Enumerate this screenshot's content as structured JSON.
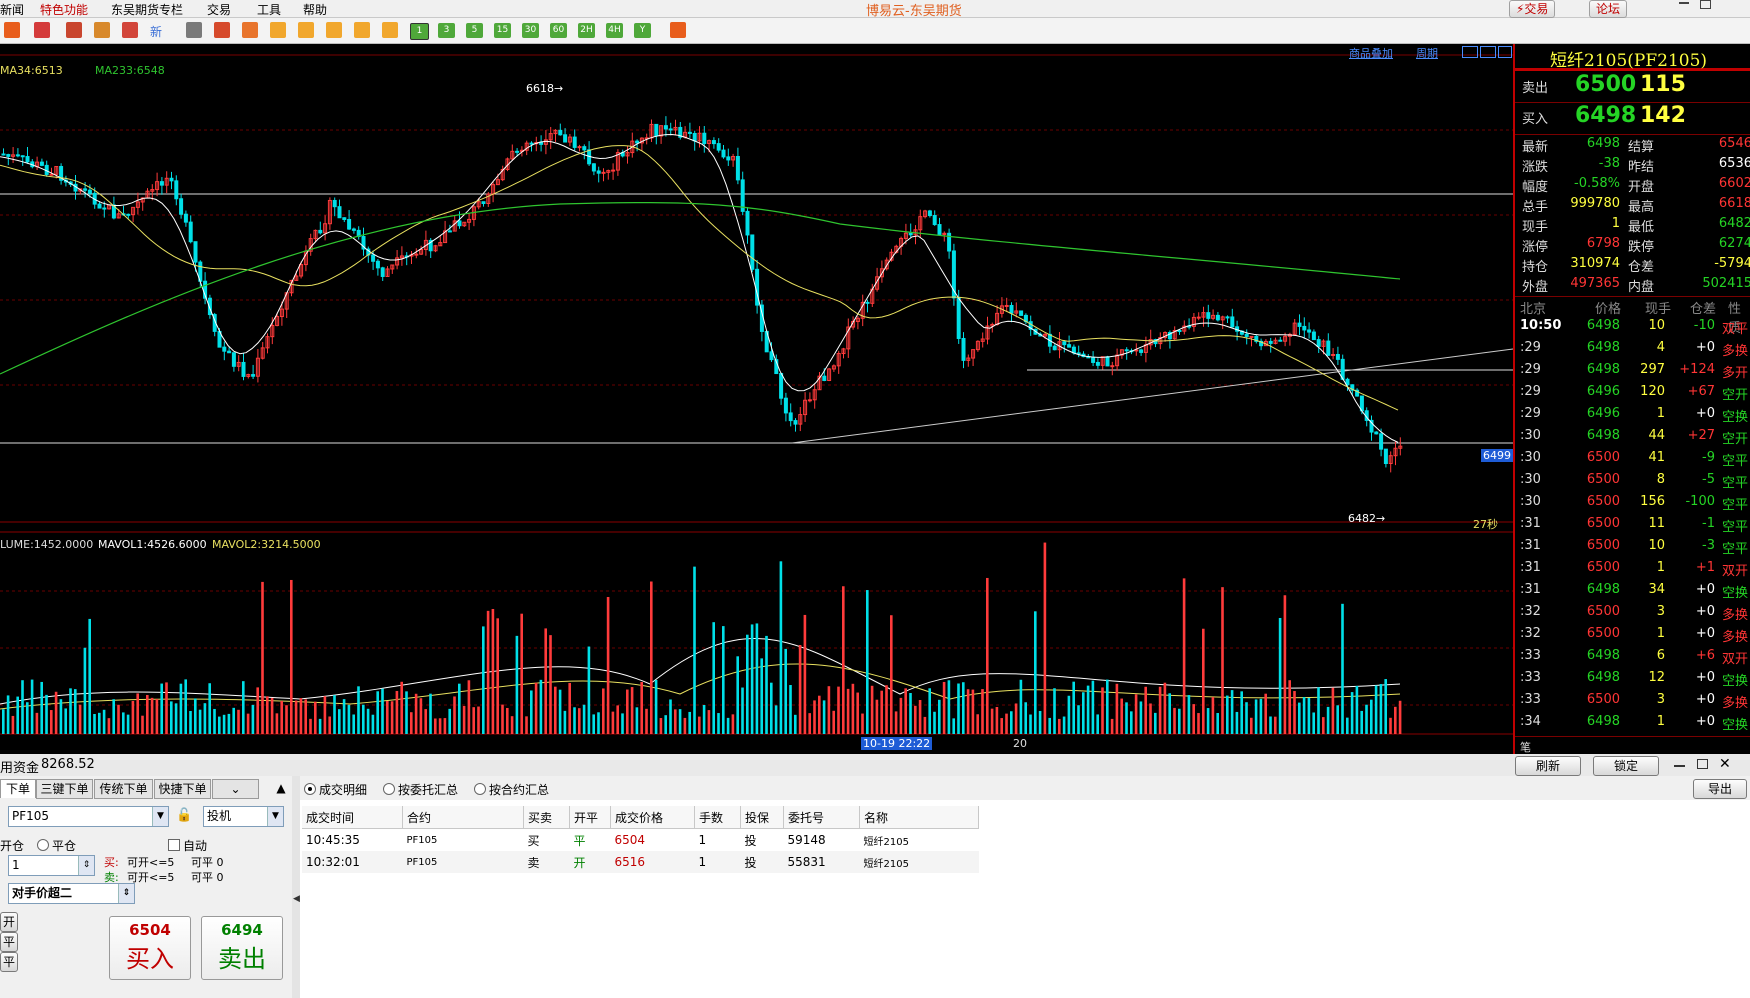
{
  "menu": {
    "items": [
      "新闻",
      "特色功能",
      "东吴期货专栏",
      "交易",
      "工具",
      "帮助"
    ],
    "app_title": "博易云-东吴期货",
    "trade_btn": "⚡交易",
    "forum_btn": "论坛"
  },
  "toolbar": {
    "new_label": "新",
    "period_buttons": [
      "1",
      "3",
      "5",
      "15",
      "30",
      "60",
      "2H",
      "4H",
      "Y"
    ]
  },
  "chart": {
    "overlay_link": "商品叠加",
    "cycle_link": "周期",
    "ma_text_a": "MA34:6513",
    "ma_text_b": "MA233:6548",
    "high_label": "6618→",
    "low_label": "6482→",
    "price_tag": "6499",
    "countdown": "27秒",
    "vol_legend_a": "LUME:1452.0000",
    "vol_legend_b": "MAVOL1:4526.6000",
    "vol_legend_c": "MAVOL2:3214.5000",
    "time_marker": "10-19 22:22",
    "day_marker": "20",
    "colors": {
      "up": "#ff3b3b",
      "down": "#00e0e8",
      "ma_short": "#e8e060",
      "ma_long": "#2fc42f",
      "ma_white": "#ffffff"
    }
  },
  "quote": {
    "title": "短纤2105(PF2105)",
    "sell_label": "卖出",
    "sell_price": "6500",
    "sell_vol": "115",
    "buy_label": "买入",
    "buy_price": "6498",
    "buy_vol": "142",
    "rows": [
      {
        "l1": "最新",
        "v1": "6498",
        "c1": "green",
        "l2": "结算",
        "v2": "6546",
        "c2": "red"
      },
      {
        "l1": "涨跌",
        "v1": "-38",
        "c1": "green",
        "l2": "昨结",
        "v2": "6536",
        "c2": "white"
      },
      {
        "l1": "幅度",
        "v1": "-0.58%",
        "c1": "green",
        "l2": "开盘",
        "v2": "6602",
        "c2": "red"
      },
      {
        "l1": "总手",
        "v1": "999780",
        "c1": "yellow",
        "l2": "最高",
        "v2": "6618",
        "c2": "red"
      },
      {
        "l1": "现手",
        "v1": "1",
        "c1": "yellow",
        "l2": "最低",
        "v2": "6482",
        "c2": "green"
      },
      {
        "l1": "涨停",
        "v1": "6798",
        "c1": "red",
        "l2": "跌停",
        "v2": "6274",
        "c2": "green"
      },
      {
        "l1": "持仓",
        "v1": "310974",
        "c1": "yellow",
        "l2": "仓差",
        "v2": "-5794",
        "c2": "yellow"
      },
      {
        "l1": "外盘",
        "v1": "497365",
        "c1": "red",
        "l2": "内盘",
        "v2": "502415",
        "c2": "green"
      }
    ],
    "tick_headers": [
      "北京",
      "价格",
      "现手",
      "仓差",
      "性质"
    ],
    "ticks": [
      {
        "t": "10:50",
        "p": "6498",
        "pc": "green",
        "v": "10",
        "d": "-10",
        "n": "双平",
        "nc": "red"
      },
      {
        "t": ":29",
        "p": "6498",
        "pc": "green",
        "v": "4",
        "d": "+0",
        "n": "多换",
        "nc": "red"
      },
      {
        "t": ":29",
        "p": "6498",
        "pc": "green",
        "v": "297",
        "d": "+124",
        "n": "多开",
        "nc": "red"
      },
      {
        "t": ":29",
        "p": "6496",
        "pc": "green",
        "v": "120",
        "d": "+67",
        "n": "空开",
        "nc": "green"
      },
      {
        "t": ":29",
        "p": "6496",
        "pc": "green",
        "v": "1",
        "d": "+0",
        "n": "空换",
        "nc": "green"
      },
      {
        "t": ":30",
        "p": "6498",
        "pc": "green",
        "v": "44",
        "d": "+27",
        "n": "空开",
        "nc": "green"
      },
      {
        "t": ":30",
        "p": "6500",
        "pc": "red",
        "v": "41",
        "d": "-9",
        "n": "空平",
        "nc": "green"
      },
      {
        "t": ":30",
        "p": "6500",
        "pc": "red",
        "v": "8",
        "d": "-5",
        "n": "空平",
        "nc": "green"
      },
      {
        "t": ":30",
        "p": "6500",
        "pc": "red",
        "v": "156",
        "d": "-100",
        "n": "空平",
        "nc": "green"
      },
      {
        "t": ":31",
        "p": "6500",
        "pc": "red",
        "v": "11",
        "d": "-1",
        "n": "空平",
        "nc": "green"
      },
      {
        "t": ":31",
        "p": "6500",
        "pc": "red",
        "v": "10",
        "d": "-3",
        "n": "空平",
        "nc": "green"
      },
      {
        "t": ":31",
        "p": "6500",
        "pc": "red",
        "v": "1",
        "d": "+1",
        "n": "双开",
        "nc": "red"
      },
      {
        "t": ":31",
        "p": "6498",
        "pc": "green",
        "v": "34",
        "d": "+0",
        "n": "空换",
        "nc": "green"
      },
      {
        "t": ":32",
        "p": "6500",
        "pc": "red",
        "v": "3",
        "d": "+0",
        "n": "多换",
        "nc": "red"
      },
      {
        "t": ":32",
        "p": "6500",
        "pc": "red",
        "v": "1",
        "d": "+0",
        "n": "多换",
        "nc": "red"
      },
      {
        "t": ":33",
        "p": "6498",
        "pc": "green",
        "v": "6",
        "d": "+6",
        "n": "双开",
        "nc": "red"
      },
      {
        "t": ":33",
        "p": "6498",
        "pc": "green",
        "v": "12",
        "d": "+0",
        "n": "空换",
        "nc": "green"
      },
      {
        "t": ":33",
        "p": "6500",
        "pc": "red",
        "v": "3",
        "d": "+0",
        "n": "多换",
        "nc": "red"
      },
      {
        "t": ":34",
        "p": "6498",
        "pc": "green",
        "v": "1",
        "d": "+0",
        "n": "空换",
        "nc": "green"
      }
    ],
    "footer": "笔"
  },
  "bottom": {
    "funds_label": "用资金",
    "funds_value": "8268.52",
    "refresh": "刷新",
    "lock": "锁定",
    "export": "导出",
    "order_tabs": [
      "下单",
      "三键下单",
      "传统下单",
      "快捷下单"
    ],
    "contract": "PF105",
    "hedge": "投机",
    "open_label": "开仓",
    "close_label": "平仓",
    "auto_label": "自动",
    "qty": "1",
    "buy_avail": "买:",
    "sell_avail": "卖:",
    "can_open": "可开<=5",
    "can_close": "可平  0",
    "price_type": "对手价超二",
    "side_btns": [
      "开",
      "平",
      "平"
    ],
    "buy_price": "6504",
    "buy_label": "买入",
    "sell_price": "6494",
    "sell_label": "卖出",
    "view_radios": [
      "成交明细",
      "按委托汇总",
      "按合约汇总"
    ],
    "table_headers": [
      "成交时间",
      "合约",
      "买卖",
      "开平",
      "成交价格",
      "手数",
      "投保",
      "委托号",
      "名称"
    ],
    "trades": [
      {
        "time": "10:45:35",
        "contract": "PF105",
        "side": "买",
        "oc": "平",
        "price": "6504",
        "qty": "1",
        "hedge": "投",
        "order_no": "59148",
        "name": "短纤2105"
      },
      {
        "time": "10:32:01",
        "contract": "PF105",
        "side": "卖",
        "oc": "开",
        "price": "6516",
        "qty": "1",
        "hedge": "投",
        "order_no": "55831",
        "name": "短纤2105"
      }
    ]
  }
}
